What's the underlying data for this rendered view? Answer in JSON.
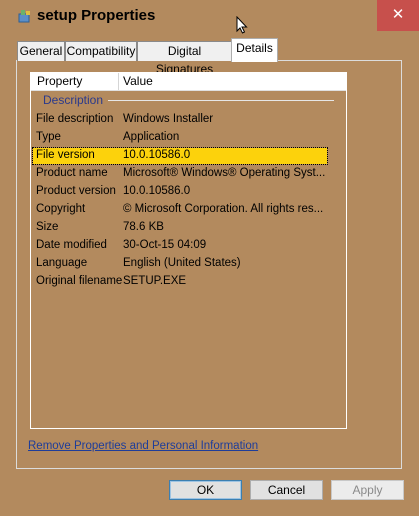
{
  "window": {
    "title": "setup Properties",
    "close_glyph": "✕",
    "app_icon": "installer-icon"
  },
  "tabs": [
    {
      "label": "General"
    },
    {
      "label": "Compatibility"
    },
    {
      "label": "Digital Signatures"
    },
    {
      "label": "Details",
      "active": true
    }
  ],
  "table": {
    "columns": [
      "Property",
      "Value"
    ],
    "group": "Description",
    "rows": [
      {
        "property": "File description",
        "value": "Windows Installer"
      },
      {
        "property": "Type",
        "value": "Application"
      },
      {
        "property": "File version",
        "value": "10.0.10586.0",
        "selected": true
      },
      {
        "property": "Product name",
        "value": "Microsoft® Windows® Operating Syst..."
      },
      {
        "property": "Product version",
        "value": "10.0.10586.0"
      },
      {
        "property": "Copyright",
        "value": "© Microsoft Corporation. All rights res..."
      },
      {
        "property": "Size",
        "value": "78.6 KB"
      },
      {
        "property": "Date modified",
        "value": "30-Oct-15 04:09"
      },
      {
        "property": "Language",
        "value": "English (United States)"
      },
      {
        "property": "Original filename",
        "value": "SETUP.EXE"
      }
    ]
  },
  "link": "Remove Properties and Personal Information",
  "buttons": {
    "ok": "OK",
    "cancel": "Cancel",
    "apply": "Apply"
  },
  "colors": {
    "background": "#b38a5e",
    "selection": "#fcd20c",
    "close": "#c7504c"
  }
}
